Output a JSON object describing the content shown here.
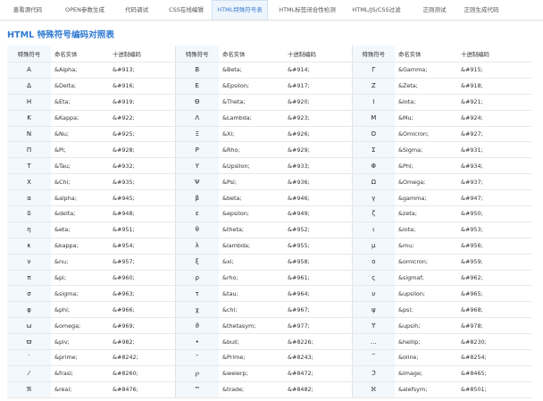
{
  "tabs": [
    {
      "label": "查看源代码",
      "active": false
    },
    {
      "label": "OPEN参数生成",
      "active": false
    },
    {
      "label": "代码调试",
      "active": false
    },
    {
      "label": "CSS在线编辑",
      "active": false
    },
    {
      "label": "HTML特殊符号表",
      "active": true
    },
    {
      "label": "HTML标签闭合性检测",
      "active": false
    },
    {
      "label": "HTML/JS/CSS过滤",
      "active": false
    },
    {
      "label": "正则测试",
      "active": false
    },
    {
      "label": "正则生成代码",
      "active": false
    }
  ],
  "page_title": "HTML 特殊符号编码对照表",
  "columns": [
    "特殊符号",
    "命名实体",
    "十进制编码"
  ],
  "rows": [
    [
      [
        "Α",
        "&Alpha;",
        "&#913;"
      ],
      [
        "Β",
        "&Beta;",
        "&#914;"
      ],
      [
        "Γ",
        "&Gamma;",
        "&#915;"
      ]
    ],
    [
      [
        "Δ",
        "&Delta;",
        "&#916;"
      ],
      [
        "Ε",
        "&Epsilon;",
        "&#917;"
      ],
      [
        "Ζ",
        "&Zeta;",
        "&#918;"
      ]
    ],
    [
      [
        "Η",
        "&Eta;",
        "&#919;"
      ],
      [
        "Θ",
        "&Theta;",
        "&#920;"
      ],
      [
        "Ι",
        "&Iota;",
        "&#921;"
      ]
    ],
    [
      [
        "Κ",
        "&Kappa;",
        "&#922;"
      ],
      [
        "Λ",
        "&Lambda;",
        "&#923;"
      ],
      [
        "Μ",
        "&Mu;",
        "&#924;"
      ]
    ],
    [
      [
        "Ν",
        "&Nu;",
        "&#925;"
      ],
      [
        "Ξ",
        "&Xi;",
        "&#926;"
      ],
      [
        "Ο",
        "&Omicron;",
        "&#927;"
      ]
    ],
    [
      [
        "Π",
        "&Pi;",
        "&#928;"
      ],
      [
        "Ρ",
        "&Rho;",
        "&#929;"
      ],
      [
        "Σ",
        "&Sigma;",
        "&#931;"
      ]
    ],
    [
      [
        "Τ",
        "&Tau;",
        "&#932;"
      ],
      [
        "Υ",
        "&Upsilon;",
        "&#933;"
      ],
      [
        "Φ",
        "&Phi;",
        "&#934;"
      ]
    ],
    [
      [
        "Χ",
        "&Chi;",
        "&#935;"
      ],
      [
        "Ψ",
        "&Psi;",
        "&#936;"
      ],
      [
        "Ω",
        "&Omega;",
        "&#937;"
      ]
    ],
    [
      [
        "α",
        "&alpha;",
        "&#945;"
      ],
      [
        "β",
        "&beta;",
        "&#946;"
      ],
      [
        "γ",
        "&gamma;",
        "&#947;"
      ]
    ],
    [
      [
        "δ",
        "&delta;",
        "&#948;"
      ],
      [
        "ε",
        "&epsilon;",
        "&#949;"
      ],
      [
        "ζ",
        "&zeta;",
        "&#950;"
      ]
    ],
    [
      [
        "η",
        "&eta;",
        "&#951;"
      ],
      [
        "θ",
        "&theta;",
        "&#952;"
      ],
      [
        "ι",
        "&iota;",
        "&#953;"
      ]
    ],
    [
      [
        "κ",
        "&kappa;",
        "&#954;"
      ],
      [
        "λ",
        "&lambda;",
        "&#955;"
      ],
      [
        "μ",
        "&mu;",
        "&#956;"
      ]
    ],
    [
      [
        "ν",
        "&nu;",
        "&#957;"
      ],
      [
        "ξ",
        "&xi;",
        "&#958;"
      ],
      [
        "ο",
        "&omicron;",
        "&#959;"
      ]
    ],
    [
      [
        "π",
        "&pi;",
        "&#960;"
      ],
      [
        "ρ",
        "&rho;",
        "&#961;"
      ],
      [
        "ς",
        "&sigmaf;",
        "&#962;"
      ]
    ],
    [
      [
        "σ",
        "&sigma;",
        "&#963;"
      ],
      [
        "τ",
        "&tau;",
        "&#964;"
      ],
      [
        "υ",
        "&upsilon;",
        "&#965;"
      ]
    ],
    [
      [
        "φ",
        "&phi;",
        "&#966;"
      ],
      [
        "χ",
        "&chi;",
        "&#967;"
      ],
      [
        "ψ",
        "&psi;",
        "&#968;"
      ]
    ],
    [
      [
        "ω",
        "&omega;",
        "&#969;"
      ],
      [
        "ϑ",
        "&thetasym;",
        "&#977;"
      ],
      [
        "ϒ",
        "&upsih;",
        "&#978;"
      ]
    ],
    [
      [
        "ϖ",
        "&piv;",
        "&#982;"
      ],
      [
        "•",
        "&bull;",
        "&#8226;"
      ],
      [
        "…",
        "&hellip;",
        "&#8230;"
      ]
    ],
    [
      [
        "′",
        "&prime;",
        "&#8242;"
      ],
      [
        "″",
        "&Prime;",
        "&#8243;"
      ],
      [
        "‾",
        "&oline;",
        "&#8254;"
      ]
    ],
    [
      [
        "⁄",
        "&frasl;",
        "&#8260;"
      ],
      [
        "℘",
        "&weierp;",
        "&#8472;"
      ],
      [
        "ℑ",
        "&image;",
        "&#8465;"
      ]
    ],
    [
      [
        "ℜ",
        "&real;",
        "&#8476;"
      ],
      [
        "™",
        "&trade;",
        "&#8482;"
      ],
      [
        "ℵ",
        "&alefsym;",
        "&#8501;"
      ]
    ]
  ]
}
